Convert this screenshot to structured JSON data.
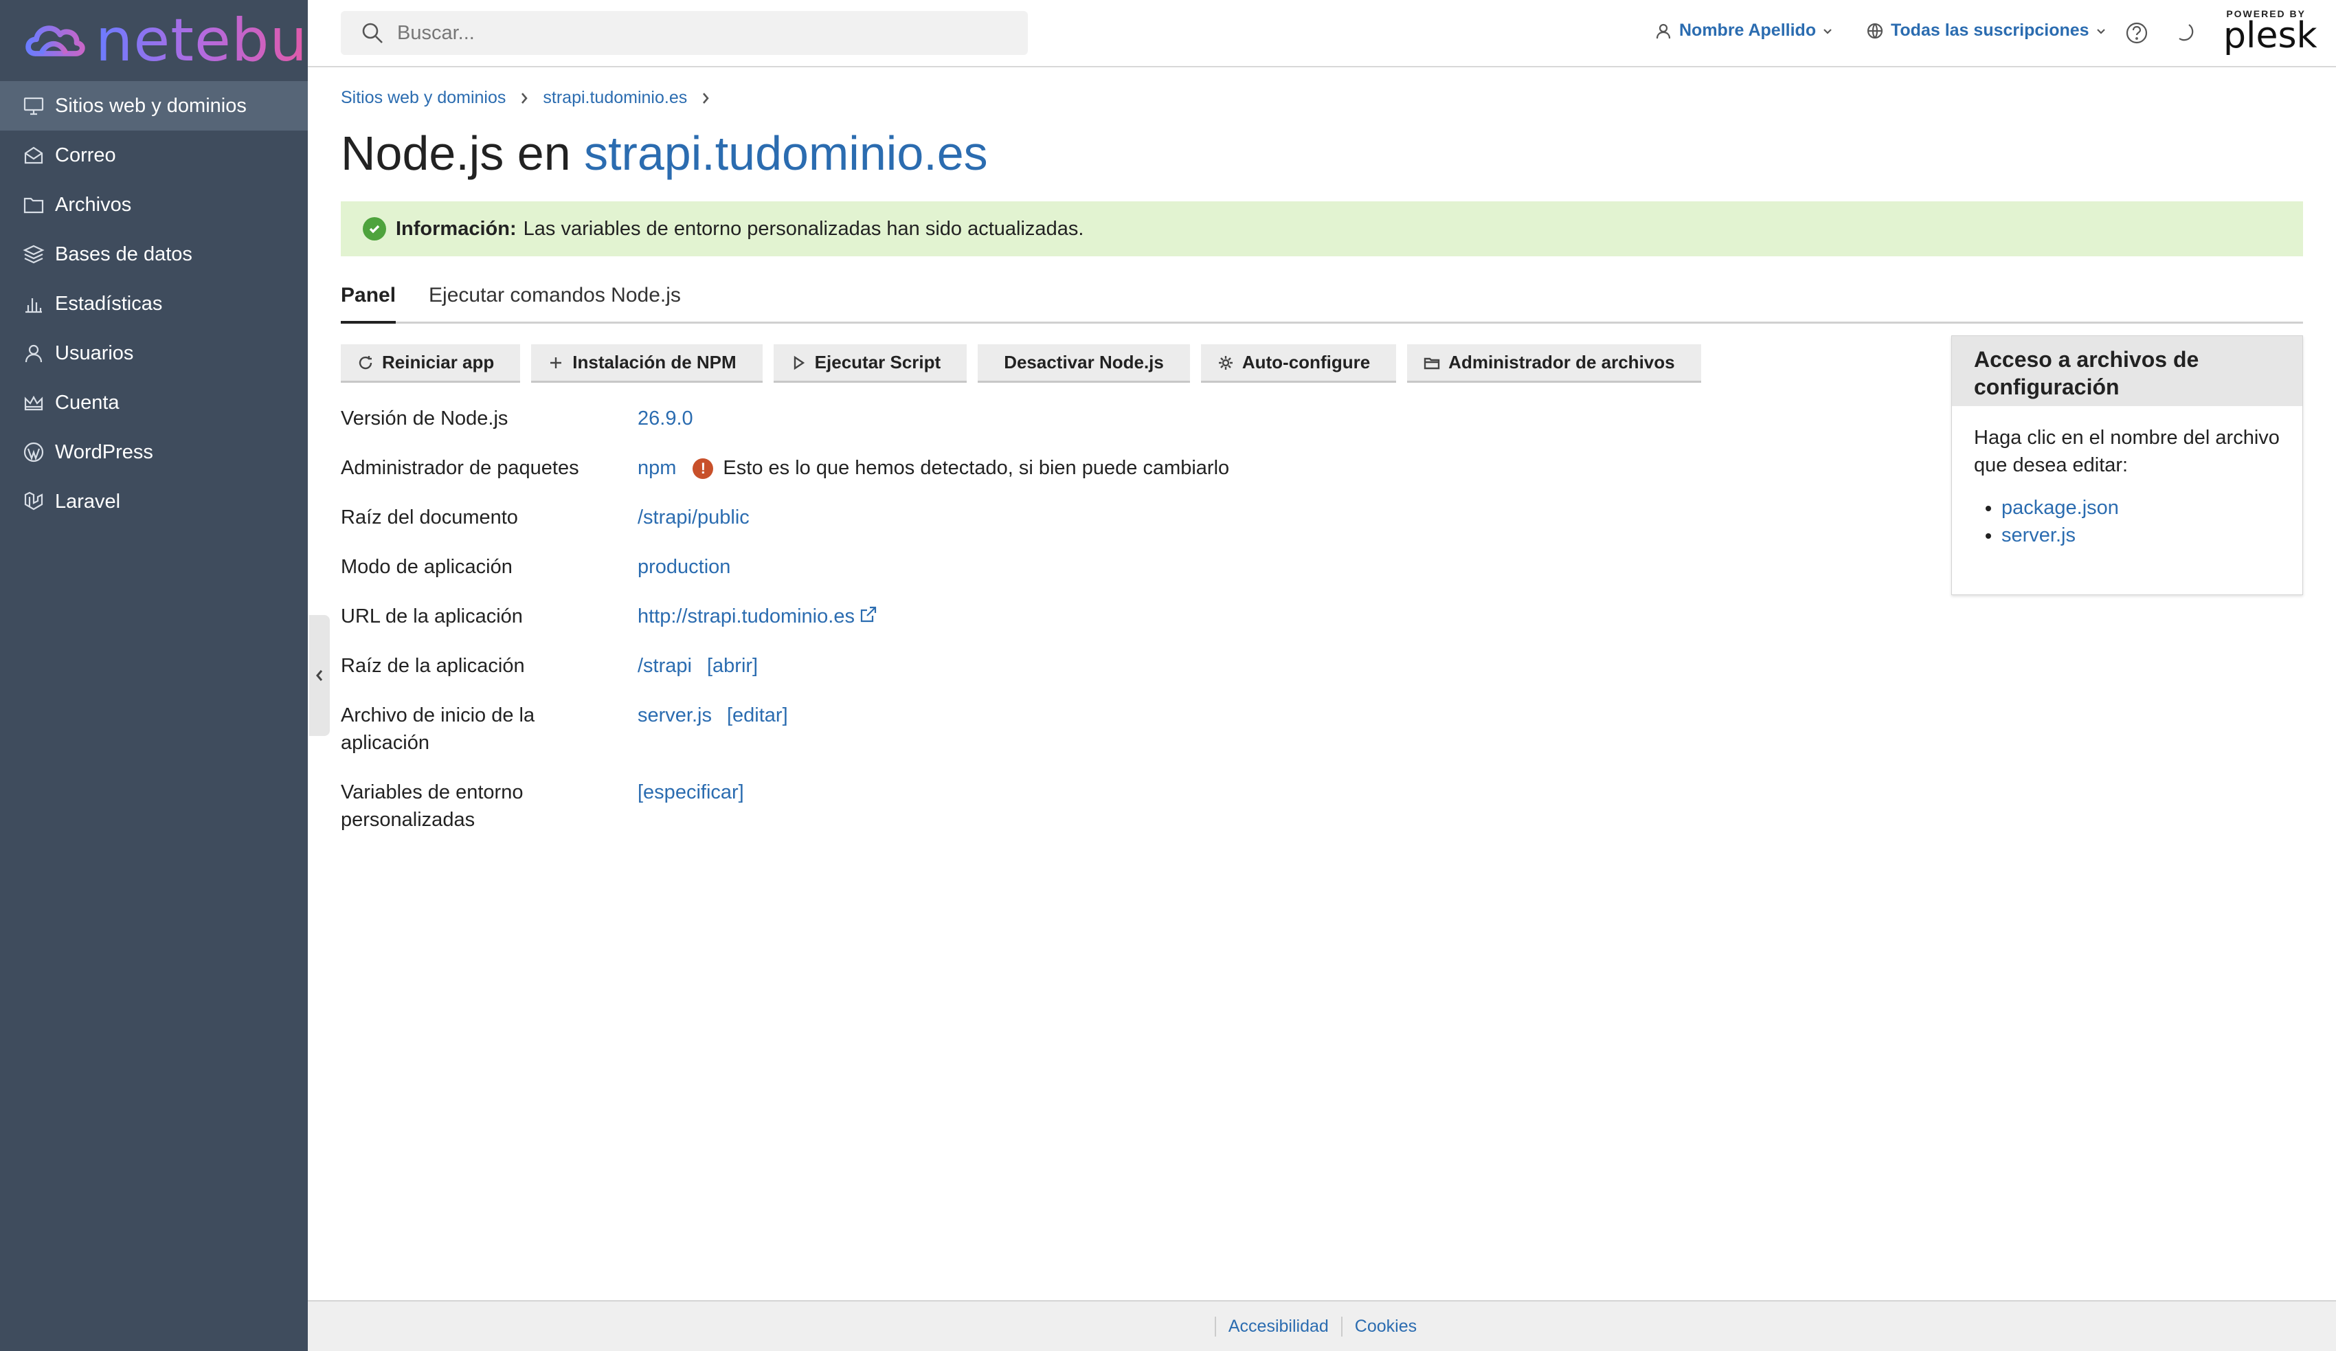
{
  "brand": {
    "logo_text": "netebu"
  },
  "sidebar": {
    "items": [
      {
        "label": "Sitios web y dominios",
        "icon": "monitor-icon",
        "active": true
      },
      {
        "label": "Correo",
        "icon": "mail-icon"
      },
      {
        "label": "Archivos",
        "icon": "folder-icon"
      },
      {
        "label": "Bases de datos",
        "icon": "database-icon"
      },
      {
        "label": "Estadísticas",
        "icon": "stats-icon"
      },
      {
        "label": "Usuarios",
        "icon": "user-icon"
      },
      {
        "label": "Cuenta",
        "icon": "crown-icon"
      },
      {
        "label": "WordPress",
        "icon": "wordpress-icon"
      },
      {
        "label": "Laravel",
        "icon": "laravel-icon"
      }
    ]
  },
  "header": {
    "search_placeholder": "Buscar...",
    "user_name": "Nombre Apellido",
    "subscriptions": "Todas las suscripciones",
    "plesk_powered": "POWERED BY",
    "plesk_word": "plesk"
  },
  "breadcrumb": {
    "items": [
      "Sitios web y dominios",
      "strapi.tudominio.es"
    ]
  },
  "page": {
    "title_prefix": "Node.js en",
    "title_link": "strapi.tudominio.es"
  },
  "alert": {
    "title": "Información:",
    "message": "Las variables de entorno personalizadas han sido actualizadas."
  },
  "tabs": [
    "Panel",
    "Ejecutar comandos Node.js"
  ],
  "toolbar": {
    "restart": "Reiniciar app",
    "npm_install": "Instalación de NPM",
    "run_script": "Ejecutar Script",
    "disable": "Desactivar Node.js",
    "autoconfigure": "Auto-configure",
    "file_manager": "Administrador de archivos"
  },
  "props": {
    "node_version": {
      "label": "Versión de Node.js",
      "value": "26.9.0"
    },
    "package_manager": {
      "label": "Administrador de paquetes",
      "value": "npm",
      "warn": "!",
      "note": "Esto es lo que hemos detectado, si bien puede cambiarlo"
    },
    "doc_root": {
      "label": "Raíz del documento",
      "value": "/strapi/public"
    },
    "app_mode": {
      "label": "Modo de aplicación",
      "value": "production"
    },
    "app_url": {
      "label": "URL de la aplicación",
      "value": "http://strapi.tudominio.es"
    },
    "app_root": {
      "label": "Raíz de la aplicación",
      "value": "/strapi",
      "extra": "[abrir]"
    },
    "startup_file": {
      "label": "Archivo de inicio de la aplicación",
      "value": "server.js",
      "extra": "[editar]"
    },
    "env_vars": {
      "label": "Variables de entorno personalizadas",
      "value": "[especificar]"
    }
  },
  "side_panel": {
    "title": "Acceso a archivos de configuración",
    "description": "Haga clic en el nombre del archivo que desea editar:",
    "files": [
      "package.json",
      "server.js"
    ]
  },
  "footer": {
    "accessibility": "Accesibilidad",
    "cookies": "Cookies"
  },
  "colors": {
    "sidebar_bg": "#3f4c5d",
    "link": "#2b6cb0",
    "alert_bg": "#e2f3d1"
  }
}
